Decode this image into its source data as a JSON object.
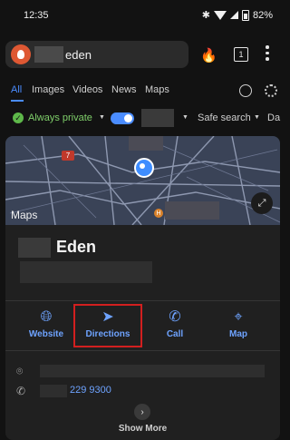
{
  "status_bar": {
    "time": "12:35",
    "battery": "82%"
  },
  "browser": {
    "query": "eden",
    "tab_count": "1"
  },
  "search_tabs": [
    "All",
    "Images",
    "Videos",
    "News",
    "Maps"
  ],
  "filters": {
    "privacy": "Always private",
    "safe_search": "Safe search",
    "date": "Da"
  },
  "map": {
    "label": "Maps",
    "route_badge": "7"
  },
  "place": {
    "name": "Eden"
  },
  "actions": [
    {
      "label": "Website",
      "icon": "globe-icon"
    },
    {
      "label": "Directions",
      "icon": "directions-icon"
    },
    {
      "label": "Call",
      "icon": "phone-icon"
    },
    {
      "label": "Map",
      "icon": "map-pin-icon"
    }
  ],
  "info": {
    "phone": "229 9300"
  },
  "show_more": "Show More",
  "colors": {
    "accent": "#4a8cff",
    "link": "#6ea3ff",
    "private": "#7fcf6a",
    "highlight": "#d21f1f"
  }
}
